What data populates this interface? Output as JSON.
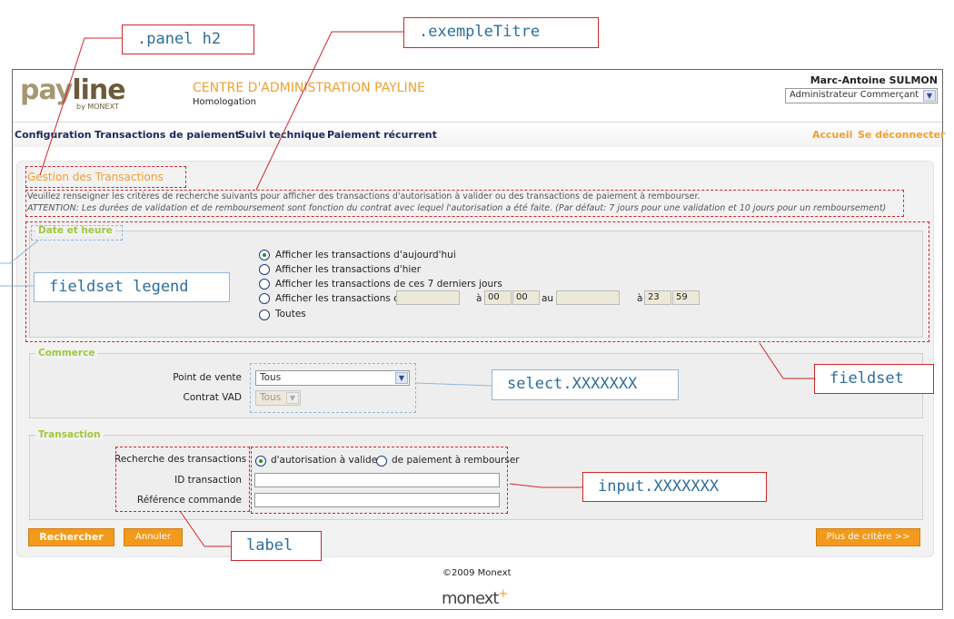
{
  "header": {
    "logo_main": "payline",
    "logo_by": "by MONEXT",
    "app_title": "CENTRE D'ADMINISTRATION PAYLINE",
    "app_subtitle": "Homologation",
    "user_name": "Marc-Antoine SULMON",
    "role_value": "Administrateur Commerçant"
  },
  "menu": {
    "items": [
      "Configuration",
      "Transactions de paiement",
      "Suivi technique",
      "Paiement récurrent"
    ],
    "home": "Accueil",
    "logout": "Se déconnecter"
  },
  "panel": {
    "title": "Gestion des Transactions",
    "description": "Veuillez renseigner les critères de recherche suivants pour afficher des transactions d'autorisation à valider ou des transactions de paiement à rembourser.",
    "warning": "ATTENTION: Les durées de validation et de remboursement sont fonction du contrat avec lequel l'autorisation a été faite. (Par défaut: 7 jours pour une validation et 10 jours pour un remboursement)"
  },
  "date_fieldset": {
    "legend": "Date et heure",
    "options": [
      "Afficher les transactions d'aujourd'hui",
      "Afficher les transactions d'hier",
      "Afficher les transactions de ces 7 derniers jours",
      "Afficher les transactions du",
      "Toutes"
    ],
    "selected_option": 0,
    "at_label": "à",
    "to_label": "au",
    "from_hour": "00",
    "from_minute": "00",
    "to_hour": "23",
    "to_minute": "59"
  },
  "commerce_fieldset": {
    "legend": "Commerce",
    "point_de_vente_label": "Point de vente",
    "point_de_vente_value": "Tous",
    "contrat_label": "Contrat VAD",
    "contrat_value": "Tous"
  },
  "transaction_fieldset": {
    "legend": "Transaction",
    "search_label": "Recherche des transactions",
    "option_authorization": "d'autorisation à valider",
    "option_refund": "de paiement à rembourser",
    "id_label": "ID transaction",
    "ref_label": "Référence commande"
  },
  "buttons": {
    "search": "Rechercher",
    "cancel": "Annuler",
    "more": "Plus  de critère >>"
  },
  "footer": {
    "copyright": "©2009 Monext",
    "logo": "monext"
  },
  "annotations": {
    "panel_h2": ".panel h2",
    "example_title": ".exempleTitre",
    "fieldset_legend": "fieldset legend",
    "select": "select.XXXXXXX",
    "fieldset": "fieldset",
    "input": "input.XXXXXXX",
    "label": "label"
  },
  "colors": {
    "accent": "#f39a1c",
    "menu_text": "#1b2a5c",
    "legend": "#a0c840",
    "annotation_red": "#d0262b",
    "annotation_blue": "#93b6d8"
  }
}
